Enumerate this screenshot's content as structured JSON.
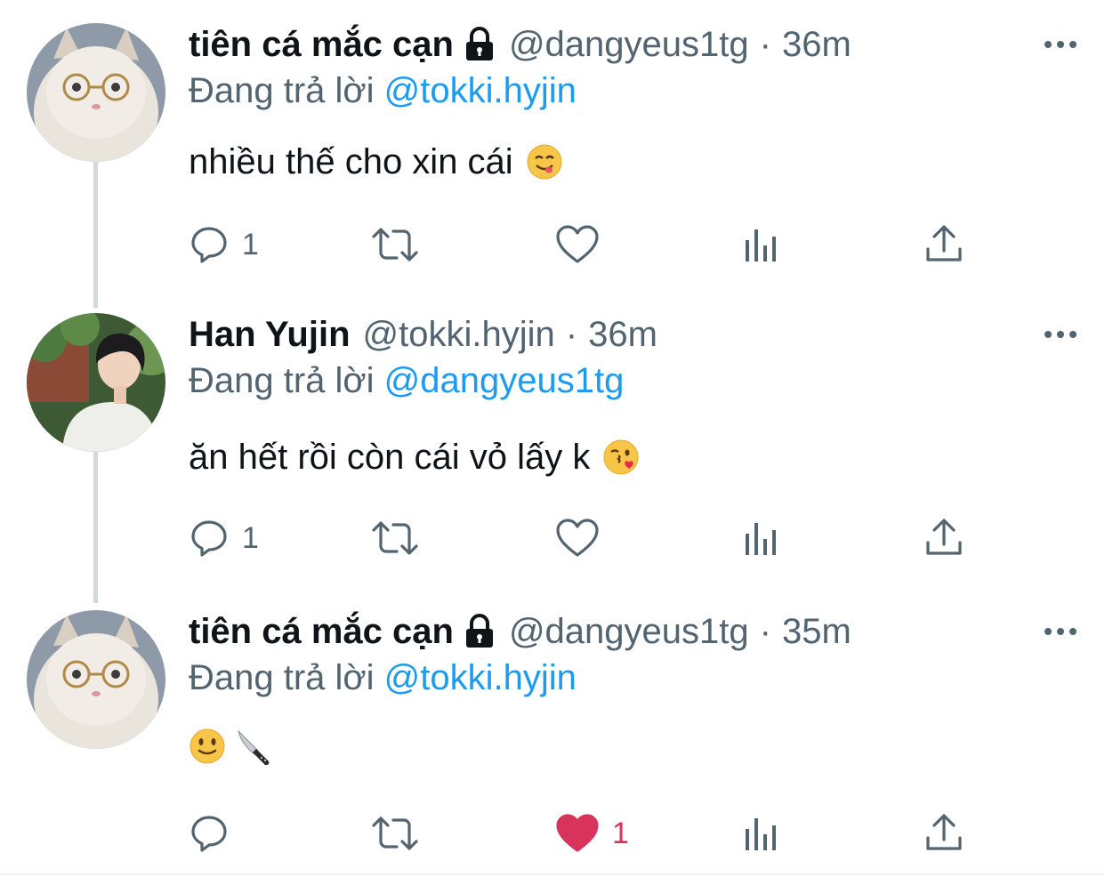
{
  "colors": {
    "text_primary": "#0f1419",
    "text_secondary": "#536471",
    "link_blue": "#1d9bf0",
    "like_red": "#f91880",
    "thread_line": "#cfd9de"
  },
  "tweets": [
    {
      "display_name": "tiên cá mắc cạn",
      "protected": true,
      "handle": "@dangyeus1tg",
      "separator": "·",
      "time": "36m",
      "reply_prefix": "Đang trả lời",
      "reply_to": "@tokki.hyjin",
      "text": "nhiều thế cho xin cái",
      "emojis": [
        "savoring-food-face-emoji"
      ],
      "reply_count": "1",
      "retweet_count": "",
      "like_count": "",
      "liked": false
    },
    {
      "display_name": "Han Yujin",
      "protected": false,
      "handle": "@tokki.hyjin",
      "separator": "·",
      "time": "36m",
      "reply_prefix": "Đang trả lời",
      "reply_to": "@dangyeus1tg",
      "text": "ăn hết rồi còn cái vỏ lấy k",
      "emojis": [
        "blowing-kiss-face-emoji"
      ],
      "reply_count": "1",
      "retweet_count": "",
      "like_count": "",
      "liked": false
    },
    {
      "display_name": "tiên cá mắc cạn",
      "protected": true,
      "handle": "@dangyeus1tg",
      "separator": "·",
      "time": "35m",
      "reply_prefix": "Đang trả lời",
      "reply_to": "@tokki.hyjin",
      "text": "",
      "emojis": [
        "slightly-smiling-face-emoji",
        "kitchen-knife-emoji"
      ],
      "reply_count": "",
      "retweet_count": "",
      "like_count": "1",
      "liked": true
    }
  ],
  "icons": {
    "more": "more-horizontal-icon",
    "reply": "reply-bubble-icon",
    "retweet": "retweet-icon",
    "like": "heart-icon",
    "views": "analytics-bars-icon",
    "share": "share-upload-icon",
    "protected": "lock-icon"
  }
}
